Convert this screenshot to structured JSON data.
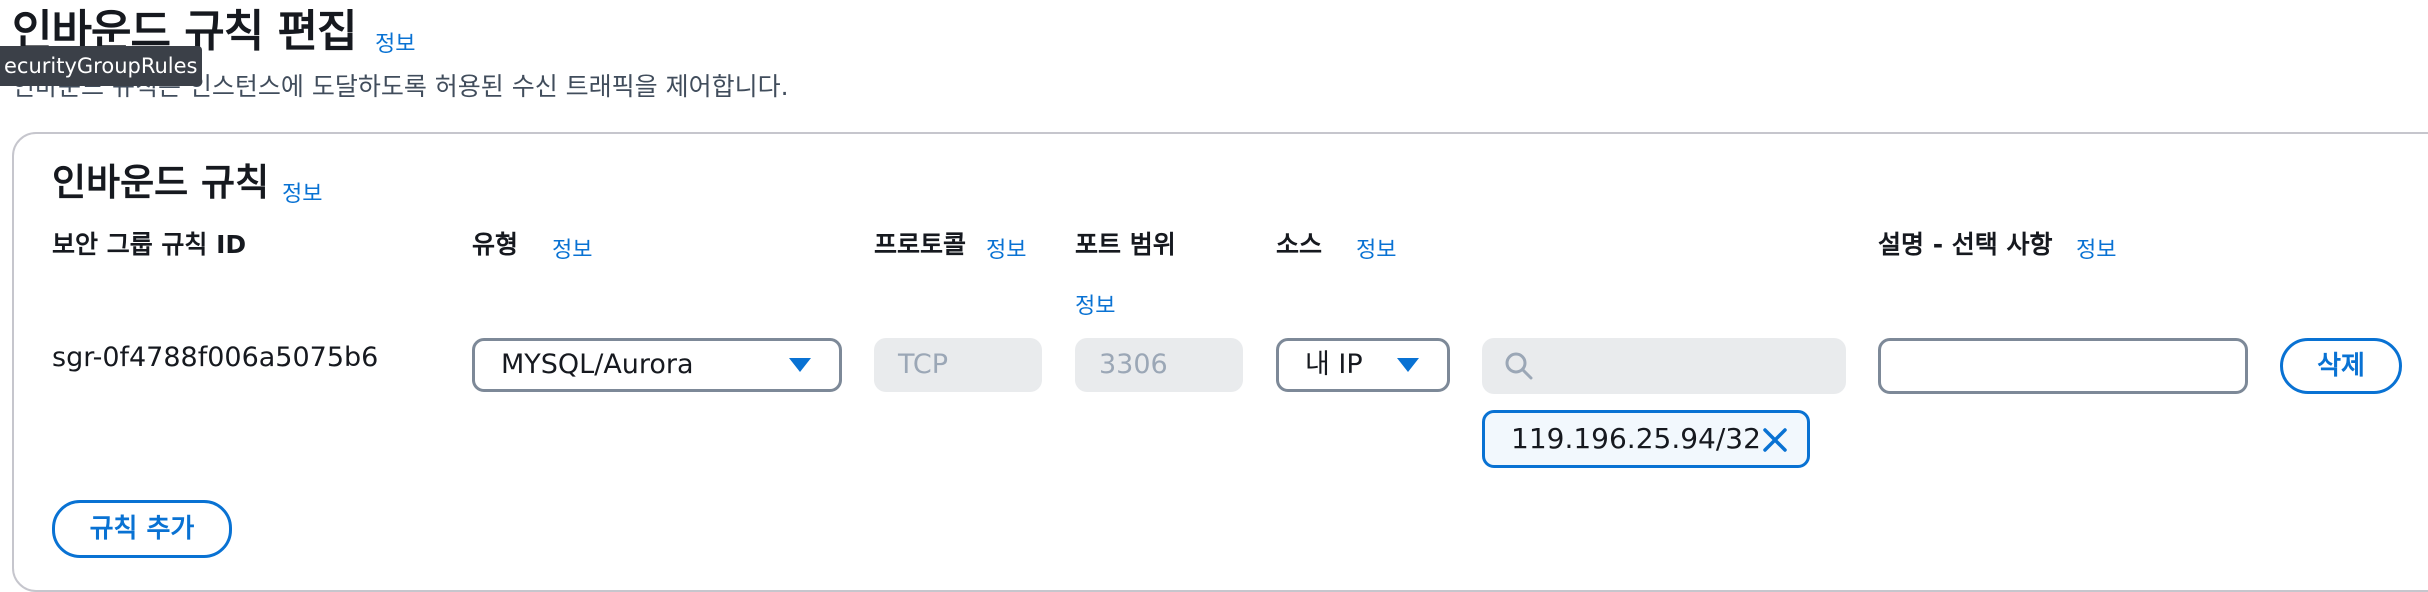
{
  "page": {
    "title": "인바운드 규칙 편집",
    "title_info": "정보",
    "description": "인바운드 규칙은 인스턴스에 도달하도록 허용된 수신 트래픽을 제어합니다.",
    "tooltip": "ecurityGroupRules"
  },
  "section": {
    "title": "인바운드 규칙",
    "info": "정보",
    "columns": {
      "rule_id": "보안 그룹 규칙 ID",
      "type": "유형",
      "type_info": "정보",
      "protocol": "프로토콜",
      "protocol_info": "정보",
      "port_range": "포트 범위",
      "port_info": "정보",
      "source": "소스",
      "source_info": "정보",
      "description": "설명 - 선택 사항",
      "description_info": "정보"
    }
  },
  "rule": {
    "id": "sgr-0f4788f006a5075b6",
    "type": "MYSQL/Aurora",
    "protocol": "TCP",
    "port": "3306",
    "source_type": "내 IP",
    "search_value": "",
    "cidr": "119.196.25.94/32",
    "description_value": "",
    "delete_label": "삭제"
  },
  "actions": {
    "add_rule": "규칙 추가"
  },
  "icons": {
    "search": "search-icon",
    "dismiss": "close-icon",
    "dropdown": "caret-down-icon"
  },
  "colors": {
    "accent": "#0972d3",
    "border": "#7d8998",
    "disabled_bg": "#e9ebed",
    "token_bg": "#f2f8fd"
  }
}
